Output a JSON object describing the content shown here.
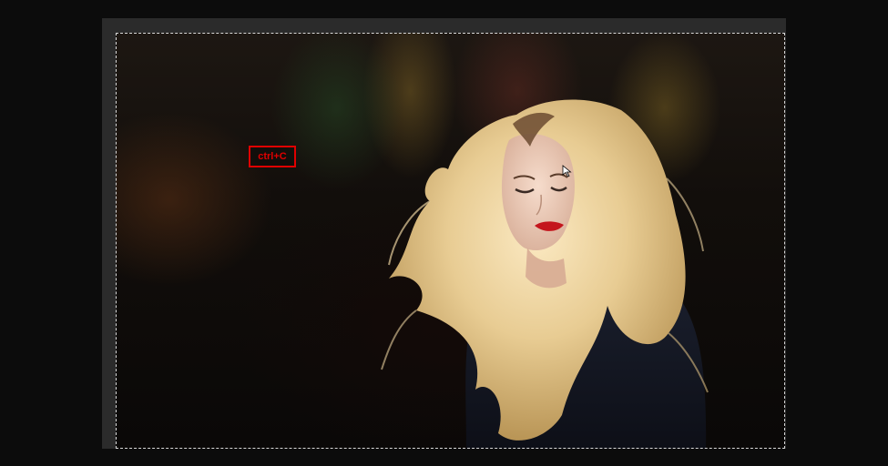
{
  "editor": {
    "background_color": "#0c0c0c",
    "pasteboard_color": "#2b2b2b"
  },
  "canvas": {
    "image_subject": "photo",
    "selection_style": "marching-ants"
  },
  "overlay": {
    "shortcut_label": "ctrl+C",
    "shortcut_color": "#e00000"
  },
  "cursor": {
    "icon": "arrow-cursor-icon"
  }
}
